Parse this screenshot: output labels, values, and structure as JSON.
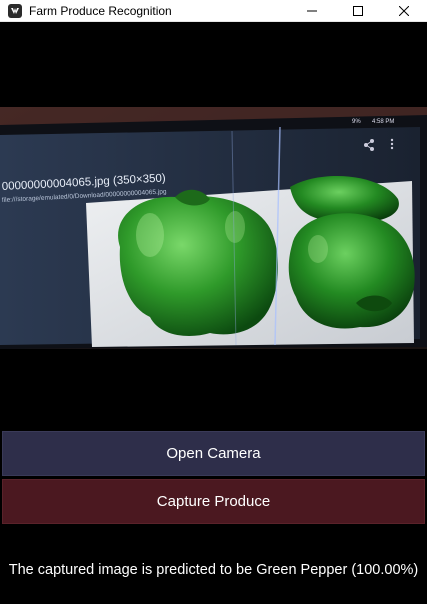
{
  "window": {
    "title": "Farm Produce Recognition",
    "controls": {
      "minimize_icon": "minimize-icon",
      "maximize_icon": "maximize-icon",
      "close_icon": "close-icon"
    }
  },
  "camera": {
    "overlay_filename": "00000000004065.jpg (350×350)",
    "overlay_path": "file:///storage/emulated/0/Download/00000000004065.jpg",
    "phone_status_time": "4:58 PM",
    "phone_battery": "9%"
  },
  "buttons": {
    "open_camera": "Open Camera",
    "capture_produce": "Capture Produce"
  },
  "result": {
    "text": "The captured image is predicted to be Green Pepper (100.00%)"
  },
  "colors": {
    "open_camera_bg": "#2e2e4a",
    "capture_bg": "#4b1820",
    "window_bg": "#000000"
  }
}
